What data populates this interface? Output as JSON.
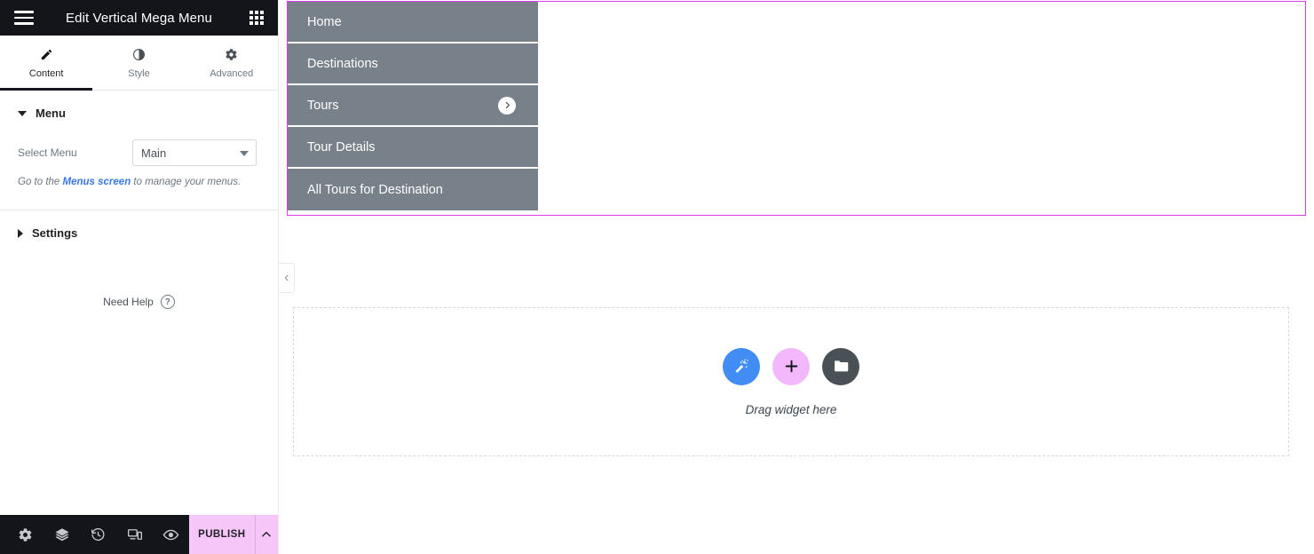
{
  "panel": {
    "header": {
      "title": "Edit Vertical Mega Menu",
      "hamburger_icon": "hamburger-menu-icon",
      "grid_icon": "widgets-grid-icon"
    },
    "tabs": [
      {
        "label": "Content",
        "icon": "pencil-icon",
        "active": true
      },
      {
        "label": "Style",
        "icon": "half-circle-contrast-icon",
        "active": false
      },
      {
        "label": "Advanced",
        "icon": "gear-icon",
        "active": false
      }
    ],
    "sections": [
      {
        "title": "Menu",
        "expanded": true
      },
      {
        "title": "Settings",
        "expanded": false
      }
    ],
    "menu_control": {
      "label": "Select Menu",
      "selected": "Main",
      "options": [
        "Main"
      ]
    },
    "help_note": {
      "prefix": "Go to the ",
      "link": "Menus screen",
      "suffix": " to manage your menus."
    },
    "need_help": {
      "label": "Need Help",
      "icon": "question-circle-icon"
    },
    "footer": {
      "tools": [
        {
          "name": "settings-gear-icon",
          "title": "Settings"
        },
        {
          "name": "navigator-layers-icon",
          "title": "Navigator"
        },
        {
          "name": "history-clock-icon",
          "title": "History"
        },
        {
          "name": "responsive-devices-icon",
          "title": "Responsive Mode"
        },
        {
          "name": "preview-eye-icon",
          "title": "Preview Changes"
        }
      ],
      "publish_label": "PUBLISH",
      "publish_caret_icon": "chevron-up-icon",
      "publish_bg": "#f5c6f7"
    },
    "collapse_handle_icon": "chevron-left-icon"
  },
  "canvas": {
    "selection_border_color": "#dc3cea",
    "megamenu": {
      "background": "#78818a",
      "items": [
        {
          "label": "Home",
          "has_arrow": false
        },
        {
          "label": "Destinations",
          "has_arrow": false
        },
        {
          "label": "Tours",
          "has_arrow": true,
          "arrow_icon": "chevron-right-circle-icon"
        },
        {
          "label": "Tour Details",
          "has_arrow": false
        },
        {
          "label": "All Tours for Destination",
          "has_arrow": false
        }
      ]
    },
    "dropzone": {
      "text": "Drag widget here",
      "buttons": [
        {
          "name": "ai-magic-wand-button",
          "icon": "magic-wand-icon",
          "color": "#418df5"
        },
        {
          "name": "add-element-button",
          "icon": "plus-icon",
          "color": "#f3b8fb"
        },
        {
          "name": "template-library-button",
          "icon": "folder-icon",
          "color": "#495157"
        }
      ]
    }
  }
}
